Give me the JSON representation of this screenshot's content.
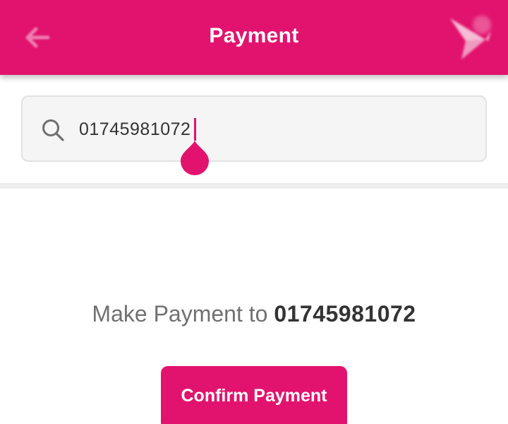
{
  "header": {
    "title": "Payment",
    "back_icon": "arrow-left-icon",
    "logo_icon": "bkash-bird-logo"
  },
  "search": {
    "icon": "search-icon",
    "value": "01745981072",
    "placeholder": ""
  },
  "payment": {
    "prefix": "Make Payment to",
    "recipient": "01745981072"
  },
  "confirm_button": {
    "label": "Confirm Payment"
  },
  "colors": {
    "brand": "#e2136e",
    "input_bg": "#f5f5f5",
    "text": "#333333",
    "muted_text": "#707070"
  }
}
